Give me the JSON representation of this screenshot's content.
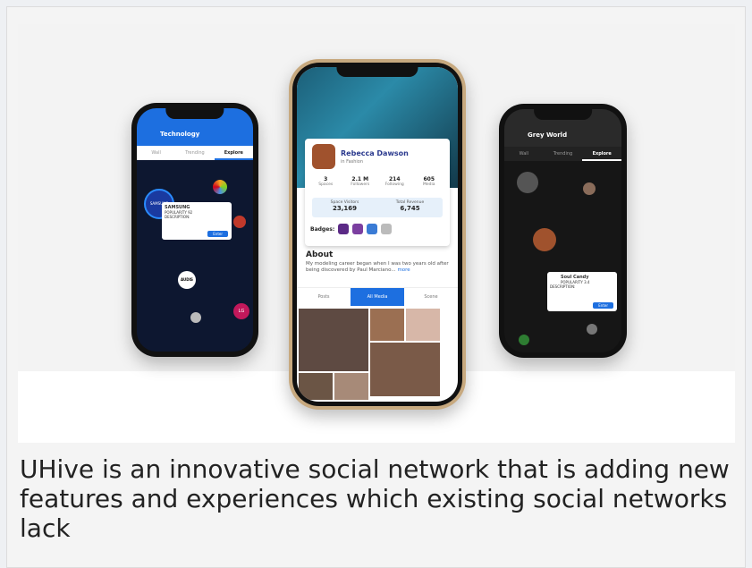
{
  "caption": "UHive is an innovative social network that is adding new features and experiences which existing social networks lack",
  "left_phone": {
    "title": "Technology",
    "tabs": [
      "Wall",
      "Trending",
      "Explore"
    ],
    "card": {
      "name": "SAMSUNG",
      "label": "POPULARITY",
      "value": "92",
      "desc_label": "DESCRIPTION:",
      "button": "Enter"
    },
    "bubbles": [
      "SAMSUNG",
      "AUDIS",
      "LG"
    ]
  },
  "right_phone": {
    "title": "Grey World",
    "tabs": [
      "Wall",
      "Trending",
      "Explore"
    ],
    "card": {
      "name": "Soul Candy",
      "label": "POPULARITY",
      "value": "3.4",
      "desc_label": "DESCRIPTION:",
      "button": "Enter"
    }
  },
  "mid_phone": {
    "profile": {
      "name": "Rebecca Dawson",
      "category": "in Fashion"
    },
    "stats": [
      {
        "value": "3",
        "label": "Spaces"
      },
      {
        "value": "2.1 M",
        "label": "Followers"
      },
      {
        "value": "214",
        "label": "Following"
      },
      {
        "value": "605",
        "label": "Media"
      }
    ],
    "revenue": {
      "visitors_label": "Space Visitors",
      "visitors": "23,169",
      "total_label": "Total Revenue",
      "total": "6,745"
    },
    "badges_label": "Badges:",
    "about": {
      "heading": "About",
      "text": "My modeling career began when I was two years old after being discovered by Paul Marciano...",
      "more": "more"
    },
    "media_tabs": [
      "Posts",
      "All Media",
      "Scene"
    ]
  },
  "colors": {
    "accent": "#1d6fe0",
    "gold": "#c7a97f"
  }
}
